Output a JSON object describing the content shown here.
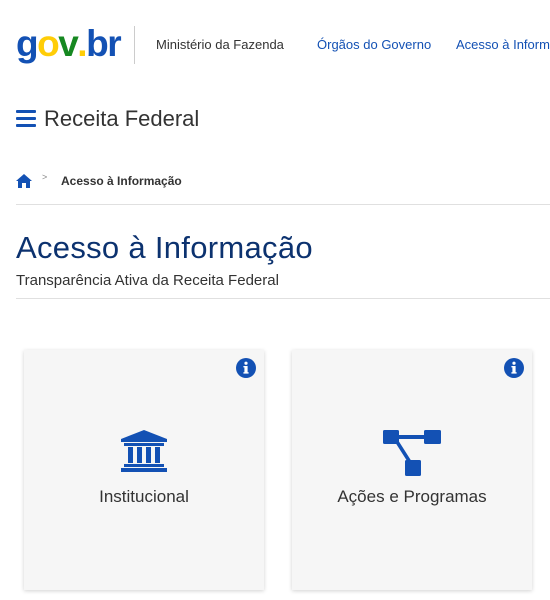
{
  "header": {
    "logo": {
      "g": "g",
      "o": "o",
      "v": "v",
      "dot": ".",
      "b": "b",
      "r": "r"
    },
    "ministry": "Ministério da Fazenda",
    "links": [
      "Órgãos do Governo",
      "Acesso à Inform"
    ]
  },
  "site": {
    "title": "Receita Federal",
    "menu_icon": "hamburger-icon"
  },
  "breadcrumb": {
    "home_icon": "home-icon",
    "separator": ">",
    "current": "Acesso à Informação"
  },
  "page": {
    "title": "Acesso à Informação",
    "subtitle": "Transparência Ativa da Receita Federal"
  },
  "cards": [
    {
      "label": "Institucional",
      "icon": "bank-icon",
      "info_icon": "info-icon"
    },
    {
      "label": "Ações e Programas",
      "icon": "sitemap-icon",
      "info_icon": "info-icon"
    }
  ],
  "colors": {
    "primary": "#1351b4",
    "title": "#0c326f",
    "card_bg": "#f6f6f6",
    "logo_blue": "#1351b4",
    "logo_yellow": "#ffcd07",
    "logo_green": "#168821"
  }
}
